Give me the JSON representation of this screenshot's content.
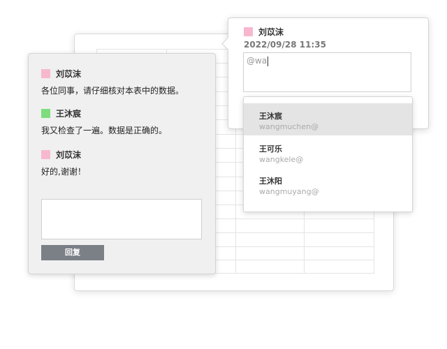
{
  "comments": [
    {
      "author": "刘苡沫",
      "color": "#f7b8cf",
      "text": "各位同事，请仔细核对本表中的数据。"
    },
    {
      "author": "王沐宸",
      "color": "#7ddd7d",
      "text": "我又检查了一遍。数据是正确的。"
    },
    {
      "author": "刘苡沫",
      "color": "#f7b8cf",
      "text": "好的,谢谢！"
    }
  ],
  "reply": {
    "button_label": "回复",
    "value": ""
  },
  "popup": {
    "author": "刘苡沫",
    "author_color": "#f7b8cf",
    "date": "2022/09/28 11:35",
    "input_value": "@wa"
  },
  "mentions": [
    {
      "name": "王沐宸",
      "handle": "wangmuchen@",
      "selected": true
    },
    {
      "name": "王可乐",
      "handle": "wangkele@",
      "selected": false
    },
    {
      "name": "王沐阳",
      "handle": "wangmuyang@",
      "selected": false
    }
  ]
}
